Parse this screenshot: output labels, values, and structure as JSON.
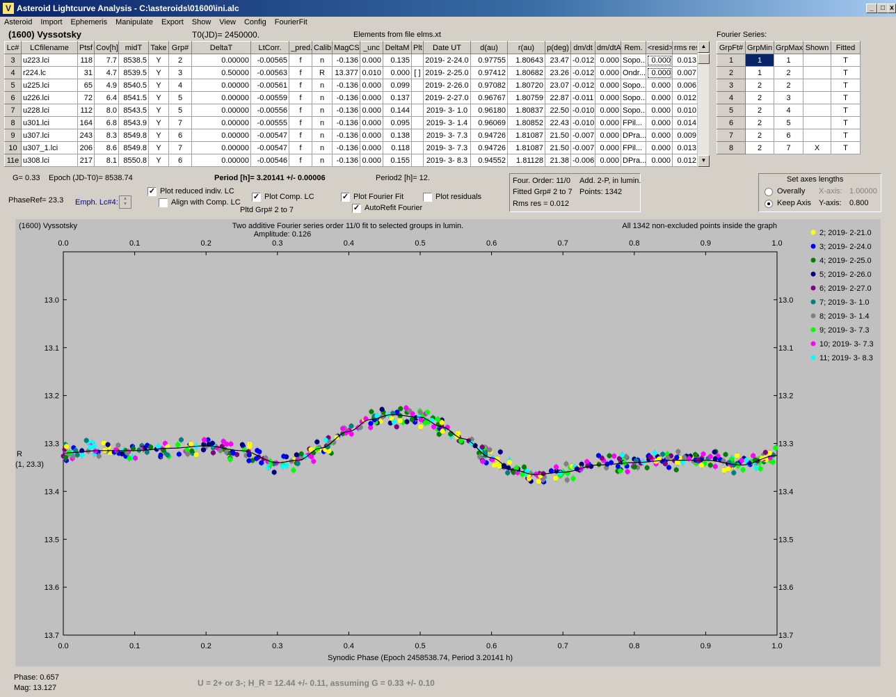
{
  "window": {
    "title": "Asteroid Lightcurve Analysis - C:\\asteroids\\01600\\ini.alc"
  },
  "menu": [
    "Asteroid",
    "Import",
    "Ephemeris",
    "Manipulate",
    "Export",
    "Show",
    "View",
    "Config",
    "FourierFit"
  ],
  "asteroid_name": "(1600) Vyssotsky",
  "t0_label": "T0(JD)= 2450000.",
  "elements_label": "Elements from file elms.xt",
  "fourier_series_label": "Fourier Series:",
  "lc_table": {
    "headers": [
      "Lc#",
      "LCfilename",
      "Ptsf",
      "Cov[h]",
      "midT",
      "Take",
      "Grp#",
      "DeltaT",
      "LtCorr.",
      "_pred.",
      "Calib.",
      "MagCS",
      "_unc",
      "DeltaM",
      "Plt",
      "Date UT",
      "d(au)",
      "r(au)",
      "p(deg)",
      "dm/dt",
      "dm/dtA",
      "Rem.",
      "<resid>",
      "rms res"
    ],
    "rows": [
      [
        "3",
        "u223.lci",
        "118",
        "7.7",
        "8538.5",
        "Y",
        "2",
        "0.00000",
        "-0.00565",
        "f",
        "n",
        "-0.136",
        "0.000",
        "0.135",
        "",
        "2019- 2-24.0",
        "0.97755",
        "1.80643",
        "23.47",
        "-0.012",
        "0.000",
        "Sopo...",
        "0.000",
        "0.013"
      ],
      [
        "4",
        "r224.lc",
        "31",
        "4.7",
        "8539.5",
        "Y",
        "3",
        "0.50000",
        "-0.00563",
        "f",
        "R",
        "13.377",
        "0.010",
        "0.000",
        "[ ]",
        "2019- 2-25.0",
        "0.97412",
        "1.80682",
        "23.26",
        "-0.012",
        "0.000",
        "Ondr...",
        "0.000",
        "0.007"
      ],
      [
        "5",
        "u225.lci",
        "65",
        "4.9",
        "8540.5",
        "Y",
        "4",
        "0.00000",
        "-0.00561",
        "f",
        "n",
        "-0.136",
        "0.000",
        "0.099",
        "",
        "2019- 2-26.0",
        "0.97082",
        "1.80720",
        "23.07",
        "-0.012",
        "0.000",
        "Sopo...",
        "0.000",
        "0.006"
      ],
      [
        "6",
        "u226.lci",
        "72",
        "6.4",
        "8541.5",
        "Y",
        "5",
        "0.00000",
        "-0.00559",
        "f",
        "n",
        "-0.136",
        "0.000",
        "0.137",
        "",
        "2019- 2-27.0",
        "0.96767",
        "1.80759",
        "22.87",
        "-0.011",
        "0.000",
        "Sopo...",
        "0.000",
        "0.012"
      ],
      [
        "7",
        "u228.lci",
        "112",
        "8.0",
        "8543.5",
        "Y",
        "5",
        "0.00000",
        "-0.00556",
        "f",
        "n",
        "-0.136",
        "0.000",
        "0.144",
        "",
        "2019- 3- 1.0",
        "0.96180",
        "1.80837",
        "22.50",
        "-0.010",
        "0.000",
        "Sopo...",
        "0.000",
        "0.010"
      ],
      [
        "8",
        "u301.lci",
        "164",
        "6.8",
        "8543.9",
        "Y",
        "7",
        "0.00000",
        "-0.00555",
        "f",
        "n",
        "-0.136",
        "0.000",
        "0.095",
        "",
        "2019- 3- 1.4",
        "0.96069",
        "1.80852",
        "22.43",
        "-0.010",
        "0.000",
        "FPil...",
        "0.000",
        "0.014"
      ],
      [
        "9",
        "u307.lci",
        "243",
        "8.3",
        "8549.8",
        "Y",
        "6",
        "0.00000",
        "-0.00547",
        "f",
        "n",
        "-0.136",
        "0.000",
        "0.138",
        "",
        "2019- 3- 7.3",
        "0.94726",
        "1.81087",
        "21.50",
        "-0.007",
        "0.000",
        "DPra...",
        "0.000",
        "0.009"
      ],
      [
        "10",
        "u307_1.lci",
        "206",
        "8.6",
        "8549.8",
        "Y",
        "7",
        "0.00000",
        "-0.00547",
        "f",
        "n",
        "-0.136",
        "0.000",
        "0.118",
        "",
        "2019- 3- 7.3",
        "0.94726",
        "1.81087",
        "21.50",
        "-0.007",
        "0.000",
        "FPil...",
        "0.000",
        "0.013"
      ],
      [
        "11e",
        "u308.lci",
        "217",
        "8.1",
        "8550.8",
        "Y",
        "6",
        "0.00000",
        "-0.00546",
        "f",
        "n",
        "-0.136",
        "0.000",
        "0.155",
        "",
        "2019- 3- 8.3",
        "0.94552",
        "1.81128",
        "21.38",
        "-0.006",
        "0.000",
        "DPra...",
        "0.000",
        "0.012"
      ]
    ]
  },
  "fourier_table": {
    "headers": [
      "GrpFt#",
      "GrpMin",
      "GrpMax",
      "Shown",
      "Fitted"
    ],
    "rows": [
      [
        "1",
        "1",
        "1",
        "",
        "T"
      ],
      [
        "2",
        "1",
        "2",
        "",
        "T"
      ],
      [
        "3",
        "2",
        "2",
        "",
        "T"
      ],
      [
        "4",
        "2",
        "3",
        "",
        "T"
      ],
      [
        "5",
        "2",
        "4",
        "",
        "T"
      ],
      [
        "6",
        "2",
        "5",
        "",
        "T"
      ],
      [
        "7",
        "2",
        "6",
        "",
        "T"
      ],
      [
        "8",
        "2",
        "7",
        "X",
        "T"
      ]
    ]
  },
  "params": {
    "g": "G= 0.33",
    "epoch": "Epoch (JD-T0)= 8538.74",
    "period": "Period [h]= 3.20141 +/- 0.00006",
    "period2": "Period2 [h]= 12.",
    "phaseref": "PhaseRef= 23.3",
    "emph": "Emph. Lc#4:"
  },
  "checkboxes": {
    "plot_reduced": {
      "label": "Plot reduced indiv. LC",
      "checked": "✓"
    },
    "align_comp": {
      "label": "Align with Comp. LC",
      "checked": ""
    },
    "plot_comp": {
      "label": "Plot Comp. LC",
      "checked": "✓"
    },
    "plot_fourier": {
      "label": "Plot Fourier Fit",
      "checked": "✓"
    },
    "autorefit": {
      "label": "AutoRefit Fourier",
      "checked": "✓"
    },
    "plot_residuals": {
      "label": "Plot residuals",
      "checked": ""
    }
  },
  "pltd_grp": "Pltd Grp#  2   to   7",
  "fit_info": {
    "order": "Four. Order: 11/0",
    "add": "Add. 2-P, in lumin.",
    "fitted": "Fitted Grp# 2 to 7",
    "points": "Points: 1342",
    "rms": "Rms res     = 0.012"
  },
  "axes_panel": {
    "title": "Set axes lengths",
    "overally": "Overally",
    "keep_axis": "Keep Axis",
    "x_axis_label": "X-axis:",
    "x_axis_value": "1.00000",
    "y_axis_label": "Y-axis:",
    "y_axis_value": "0.800"
  },
  "status": {
    "phase": "Phase:  0.657",
    "mag": "Mag:    13.127",
    "summary": "U = 2+ or 3-; H_R = 12.44 +/- 0.11, assuming G = 0.33 +/- 0.10"
  },
  "chart_data": {
    "type": "scatter",
    "title_left": "(1600) Vyssotsky",
    "title": "Two additive Fourier series order 11/0 fit to selected groups in lumin.",
    "amplitude": "Amplitude: 0.126",
    "title_right": "All 1342 non-excluded points inside the graph",
    "xlabel": "Synodic Phase (Epoch 2458538.74, Period 3.20141 h)",
    "ylabel": "R",
    "ylabel2": "(1, 23.3)",
    "xlim": [
      0.0,
      1.0
    ],
    "ylim": [
      13.7,
      12.9
    ],
    "x_ticks": [
      "0.0",
      "0.1",
      "0.2",
      "0.3",
      "0.4",
      "0.5",
      "0.6",
      "0.7",
      "0.8",
      "0.9",
      "1.0"
    ],
    "y_ticks": [
      "13.0",
      "13.1",
      "13.2",
      "13.3",
      "13.4",
      "13.5",
      "13.6",
      "13.7"
    ],
    "fit_curve": {
      "x": [
        0.0,
        0.05,
        0.1,
        0.15,
        0.2,
        0.25,
        0.3,
        0.33,
        0.36,
        0.4,
        0.43,
        0.46,
        0.5,
        0.53,
        0.56,
        0.6,
        0.63,
        0.66,
        0.7,
        0.75,
        0.8,
        0.85,
        0.9,
        0.95,
        1.0
      ],
      "y": [
        13.32,
        13.315,
        13.315,
        13.31,
        13.305,
        13.315,
        13.34,
        13.335,
        13.31,
        13.275,
        13.25,
        13.24,
        13.245,
        13.265,
        13.29,
        13.33,
        13.355,
        13.365,
        13.36,
        13.345,
        13.34,
        13.335,
        13.335,
        13.345,
        13.325
      ]
    },
    "series": [
      {
        "name": "2; 2019- 2-21.0",
        "color": "#ffff00"
      },
      {
        "name": "3; 2019- 2-24.0",
        "color": "#0000ff"
      },
      {
        "name": "4; 2019- 2-25.0",
        "color": "#008000"
      },
      {
        "name": "5; 2019- 2-26.0",
        "color": "#000080"
      },
      {
        "name": "6; 2019- 2-27.0",
        "color": "#800080"
      },
      {
        "name": "7; 2019- 3- 1.0",
        "color": "#008080"
      },
      {
        "name": "8; 2019- 3- 1.4",
        "color": "#808080"
      },
      {
        "name": "9; 2019- 3- 7.3",
        "color": "#00ff00"
      },
      {
        "name": "10; 2019- 3- 7.3",
        "color": "#ff00ff"
      },
      {
        "name": "11; 2019- 3- 8.3",
        "color": "#00ffff"
      }
    ]
  }
}
